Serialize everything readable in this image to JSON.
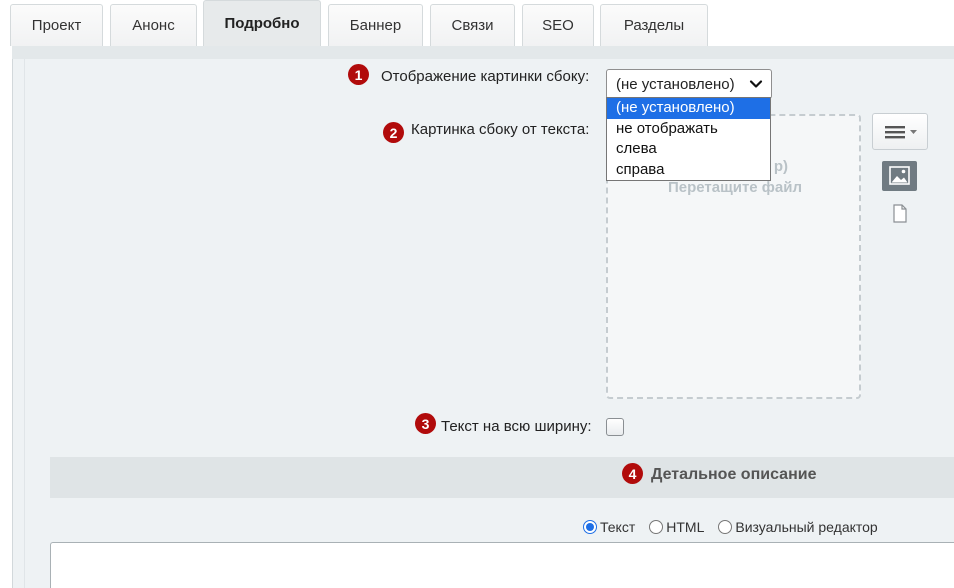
{
  "tabs": [
    {
      "label": "Проект"
    },
    {
      "label": "Анонс"
    },
    {
      "label": "Подробно",
      "active": true
    },
    {
      "label": "Баннер"
    },
    {
      "label": "Связи"
    },
    {
      "label": "SEO"
    },
    {
      "label": "Разделы"
    }
  ],
  "fields": {
    "side_image_display": {
      "badge": "1",
      "label": "Отображение картинки сбоку:",
      "selected": "(не установлено)",
      "options": [
        "(не установлено)",
        "не отображать",
        "слева",
        "справа"
      ]
    },
    "side_image": {
      "badge": "2",
      "label": "Картинка сбоку от текста:",
      "dropzone_line1": "р)",
      "dropzone_line2": "Перетащите файл",
      "menu_icon": "hamburger-dropdown-icon",
      "image_icon": "image-icon",
      "file_icon": "file-icon"
    },
    "full_width_text": {
      "badge": "3",
      "label": "Текст на всю ширину:",
      "checked": false
    }
  },
  "detail_section": {
    "badge": "4",
    "title": "Детальное описание",
    "modes": [
      {
        "label": "Текст",
        "selected": true
      },
      {
        "label": "HTML",
        "selected": false
      },
      {
        "label": "Визуальный редактор",
        "selected": false
      }
    ]
  },
  "colors": {
    "badge": "#b10b0b",
    "selection": "#1e6fe6",
    "panel": "#eef2f4"
  }
}
